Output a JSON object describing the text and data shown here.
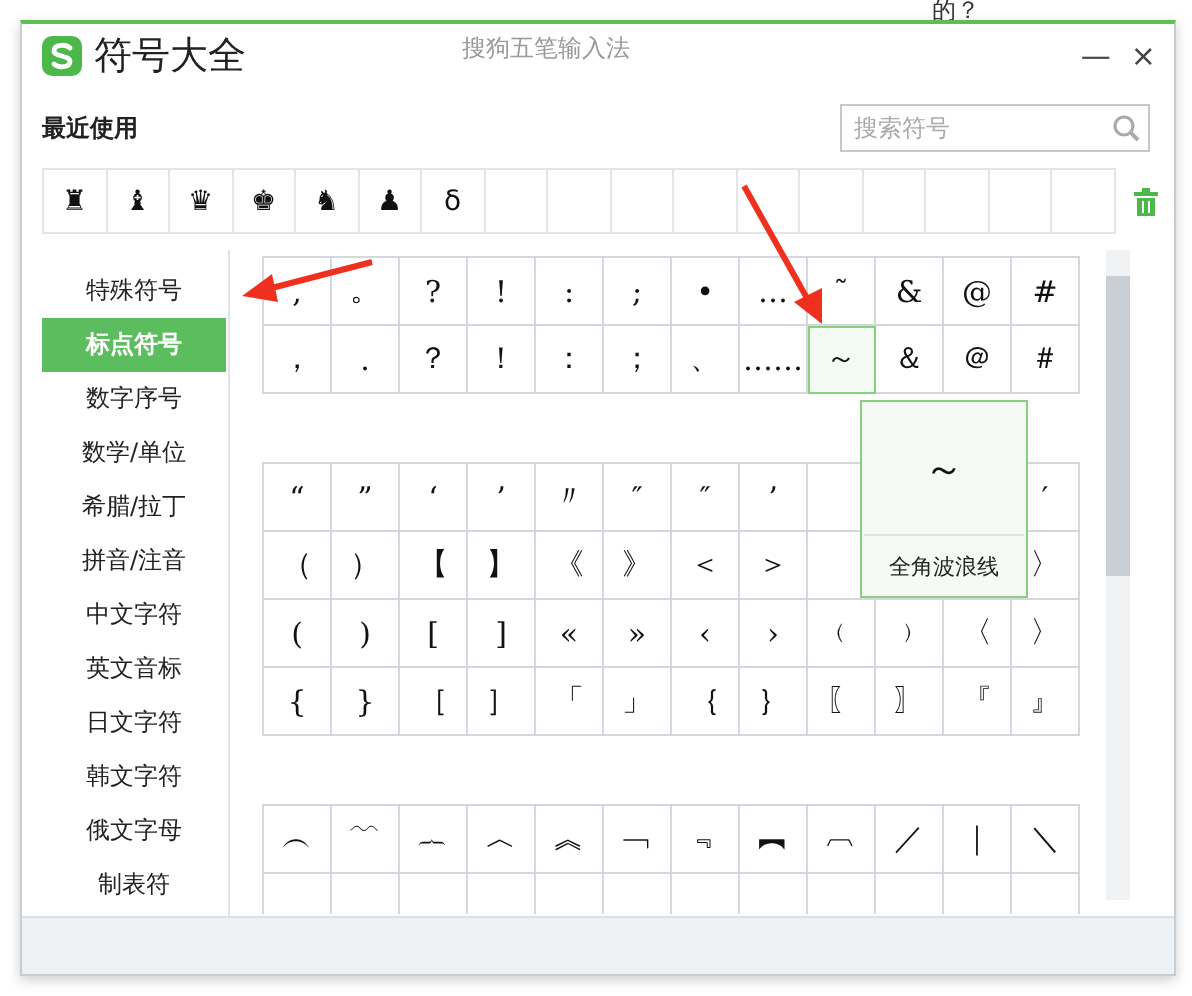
{
  "background_text": [
    "的？"
  ],
  "window": {
    "title": "符号大全",
    "subtitle": "搜狗五笔输入法",
    "controls": [
      "—",
      "×"
    ]
  },
  "recent": {
    "label": "最近使用",
    "symbols": [
      "♜",
      "♝",
      "♛",
      "♚",
      "♞",
      "♟",
      "δ"
    ]
  },
  "search": {
    "placeholder": "搜索符号"
  },
  "categories": [
    {
      "label": "特殊符号",
      "selected": false
    },
    {
      "label": "标点符号",
      "selected": true
    },
    {
      "label": "数字序号",
      "selected": false
    },
    {
      "label": "数学/单位",
      "selected": false
    },
    {
      "label": "希腊/拉丁",
      "selected": false
    },
    {
      "label": "拼音/注音",
      "selected": false
    },
    {
      "label": "中文字符",
      "selected": false
    },
    {
      "label": "英文音标",
      "selected": false
    },
    {
      "label": "日文字符",
      "selected": false
    },
    {
      "label": "韩文字符",
      "selected": false
    },
    {
      "label": "俄文字母",
      "selected": false
    },
    {
      "label": "制表符",
      "selected": false
    }
  ],
  "symbol_blocks": [
    {
      "rows": [
        [
          {
            "symbol": ",",
            "hovered": false
          },
          {
            "symbol": "。",
            "hovered": false
          },
          {
            "symbol": "?",
            "hovered": false
          },
          {
            "symbol": "!",
            "hovered": false
          },
          {
            "symbol": ":",
            "hovered": false
          },
          {
            "symbol": ";",
            "hovered": false
          },
          {
            "symbol": "•",
            "hovered": false
          },
          {
            "symbol": "…",
            "hovered": false
          },
          {
            "symbol": "˜",
            "hovered": false
          },
          {
            "symbol": "&",
            "hovered": false
          },
          {
            "symbol": "@",
            "hovered": false
          },
          {
            "symbol": "#",
            "hovered": false
          }
        ],
        [
          {
            "symbol": "，",
            "hovered": false
          },
          {
            "symbol": ".",
            "hovered": false
          },
          {
            "symbol": "？",
            "hovered": false
          },
          {
            "symbol": "！",
            "hovered": false
          },
          {
            "symbol": "：",
            "hovered": false
          },
          {
            "symbol": "；",
            "hovered": false
          },
          {
            "symbol": "、",
            "hovered": false
          },
          {
            "symbol": "……",
            "hovered": false
          },
          {
            "symbol": "～",
            "hovered": true
          },
          {
            "symbol": "＆",
            "hovered": false
          },
          {
            "symbol": "＠",
            "hovered": false
          },
          {
            "symbol": "＃",
            "hovered": false
          }
        ]
      ]
    },
    {
      "rows": [
        [
          {
            "symbol": "“",
            "hovered": false
          },
          {
            "symbol": "”",
            "hovered": false
          },
          {
            "symbol": "‘",
            "hovered": false
          },
          {
            "symbol": "’",
            "hovered": false
          },
          {
            "symbol": "〃",
            "hovered": false
          },
          {
            "symbol": "″",
            "hovered": false
          },
          {
            "symbol": "″",
            "hovered": false
          },
          {
            "symbol": "’",
            "hovered": false
          },
          {},
          {},
          {},
          {
            "symbol": "′",
            "hovered": false
          }
        ],
        [
          {
            "symbol": "（",
            "hovered": false
          },
          {
            "symbol": "）",
            "hovered": false
          },
          {
            "symbol": "【",
            "hovered": false
          },
          {
            "symbol": "】",
            "hovered": false
          },
          {
            "symbol": "《",
            "hovered": false
          },
          {
            "symbol": "》",
            "hovered": false
          },
          {
            "symbol": "＜",
            "hovered": false
          },
          {
            "symbol": "＞",
            "hovered": false
          },
          {},
          {},
          {},
          {
            "symbol": "〉",
            "hovered": false
          }
        ],
        [
          {
            "symbol": "(",
            "hovered": false
          },
          {
            "symbol": ")",
            "hovered": false
          },
          {
            "symbol": "[",
            "hovered": false
          },
          {
            "symbol": "]",
            "hovered": false
          },
          {
            "symbol": "«",
            "hovered": false
          },
          {
            "symbol": "»",
            "hovered": false
          },
          {
            "symbol": "‹",
            "hovered": false
          },
          {
            "symbol": "›",
            "hovered": false
          },
          {
            "symbol": "﹙",
            "hovered": false
          },
          {
            "symbol": "﹚",
            "hovered": false
          },
          {
            "symbol": "〈",
            "hovered": false
          },
          {
            "symbol": "〉",
            "hovered": false
          }
        ],
        [
          {
            "symbol": "{",
            "hovered": false
          },
          {
            "symbol": "}",
            "hovered": false
          },
          {
            "symbol": "［",
            "hovered": false
          },
          {
            "symbol": "］",
            "hovered": false
          },
          {
            "symbol": "「",
            "hovered": false
          },
          {
            "symbol": "」",
            "hovered": false
          },
          {
            "symbol": "｛",
            "hovered": false
          },
          {
            "symbol": "｝",
            "hovered": false
          },
          {
            "symbol": "〖",
            "hovered": false
          },
          {
            "symbol": "〗",
            "hovered": false
          },
          {
            "symbol": "『",
            "hovered": false
          },
          {
            "symbol": "』",
            "hovered": false
          }
        ]
      ]
    },
    {
      "rows": [
        [
          {
            "symbol": "︵",
            "hovered": false
          },
          {
            "symbol": "﹋",
            "hovered": false
          },
          {
            "symbol": "︷",
            "hovered": false
          },
          {
            "symbol": "︿",
            "hovered": false
          },
          {
            "symbol": "︽",
            "hovered": false
          },
          {
            "symbol": "﹁",
            "hovered": false
          },
          {
            "symbol": "﹃",
            "hovered": false
          },
          {
            "symbol": "︻",
            "hovered": false
          },
          {
            "symbol": "︹",
            "hovered": false
          },
          {
            "symbol": "／",
            "hovered": false
          },
          {
            "symbol": "｜",
            "hovered": false
          },
          {
            "symbol": "＼",
            "hovered": false
          }
        ],
        [
          {
            "hovered": false
          },
          {
            "hovered": false
          },
          {
            "hovered": false
          },
          {
            "hovered": false
          },
          {
            "hovered": false
          },
          {
            "hovered": false
          },
          {
            "hovered": false
          },
          {
            "hovered": false
          },
          {
            "hovered": false
          },
          {
            "hovered": false
          },
          {
            "hovered": false
          },
          {
            "hovered": false
          }
        ]
      ]
    }
  ],
  "tooltip": {
    "symbol": "～",
    "name": "全角波浪线"
  }
}
